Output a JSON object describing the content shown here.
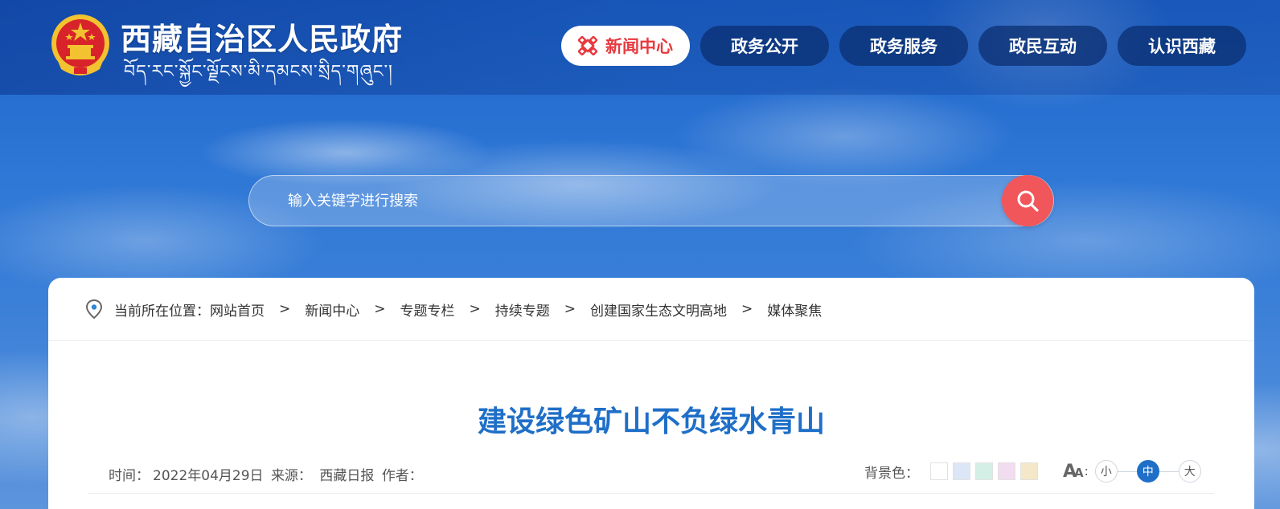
{
  "header": {
    "site_title": "西藏自治区人民政府",
    "site_subtitle": "བོད་རང་སྐྱོང་ལྗོངས་མི་དམངས་སྲིད་གཞུང་།",
    "nav": [
      {
        "label": "新闻中心",
        "active": true
      },
      {
        "label": "政务公开",
        "active": false
      },
      {
        "label": "政务服务",
        "active": false
      },
      {
        "label": "政民互动",
        "active": false
      },
      {
        "label": "认识西藏",
        "active": false
      }
    ]
  },
  "search": {
    "placeholder": "输入关键字进行搜索"
  },
  "breadcrumb": {
    "prefix": "当前所在位置：",
    "items": [
      "网站首页",
      "新闻中心",
      "专题专栏",
      "持续专题",
      "创建国家生态文明高地",
      "媒体聚焦"
    ],
    "separator": ">"
  },
  "article": {
    "title": "建设绿色矿山不负绿水青山",
    "time_label": "时间：",
    "time_value": "2022年04月29日",
    "source_label": "来源：",
    "source_value": "西藏日报",
    "author_label": "作者："
  },
  "tools": {
    "bg_label": "背景色：",
    "bg_colors": [
      "#ffffff",
      "#dbe7f7",
      "#d4efe6",
      "#f2dcef",
      "#f5e8c8"
    ],
    "font_label": "A",
    "font_label_small": "A",
    "font_colon": ":",
    "sizes": [
      {
        "label": "小",
        "active": false
      },
      {
        "label": "中",
        "active": true
      },
      {
        "label": "大",
        "active": false
      }
    ]
  },
  "colors": {
    "accent": "#1f6fc8",
    "active_nav_text": "#e8393e",
    "search_button": "#f0565a"
  }
}
